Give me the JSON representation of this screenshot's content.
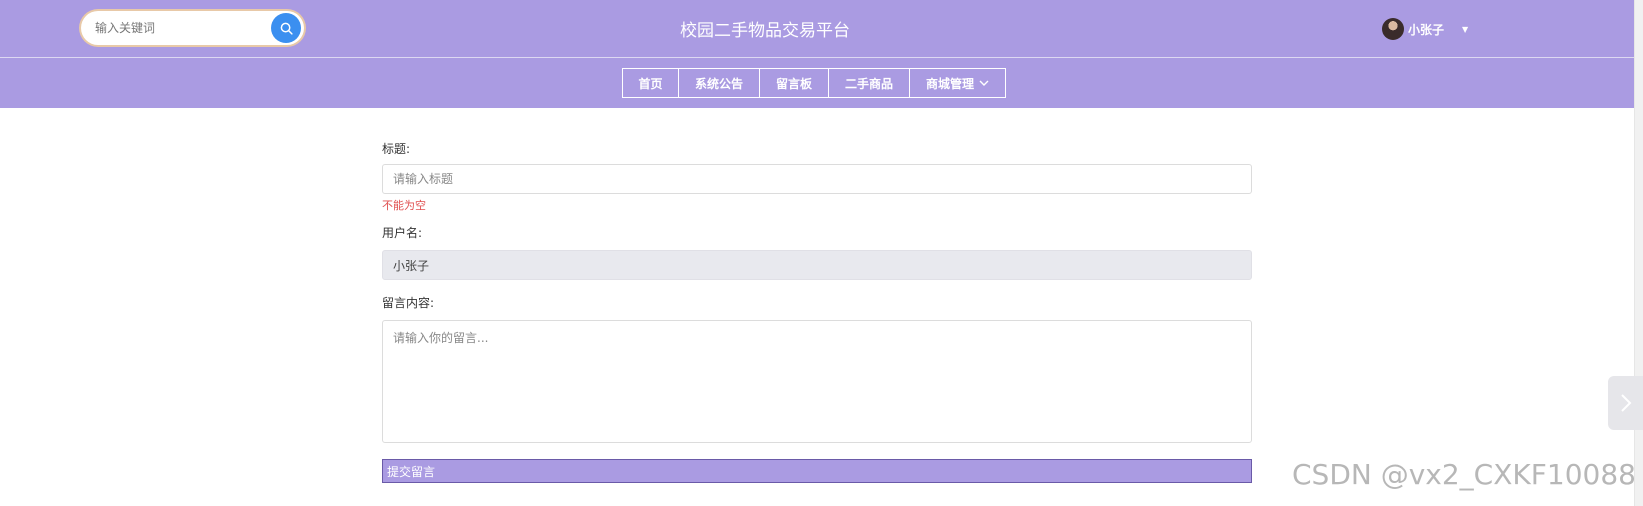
{
  "header": {
    "search_placeholder": "输入关键词",
    "site_title": "校园二手物品交易平台",
    "username": "小张子"
  },
  "nav": {
    "items": [
      "首页",
      "系统公告",
      "留言板",
      "二手商品",
      "商城管理"
    ]
  },
  "form": {
    "title_label": "标题:",
    "title_placeholder": "请输入标题",
    "title_error": "不能为空",
    "username_label": "用户名:",
    "username_value": "小张子",
    "content_label": "留言内容:",
    "content_placeholder": "请输入你的留言...",
    "submit_label": "提交留言"
  },
  "watermark": "CSDN @vx2_CXKF10088",
  "icons": {
    "search": "search-icon",
    "caret": "caret-down-icon",
    "chevron": "chevron-down-icon",
    "next": "chevron-right-icon"
  },
  "colors": {
    "header_bg": "#aa9be2",
    "search_button": "#3b8ff0",
    "error": "#e05050"
  }
}
